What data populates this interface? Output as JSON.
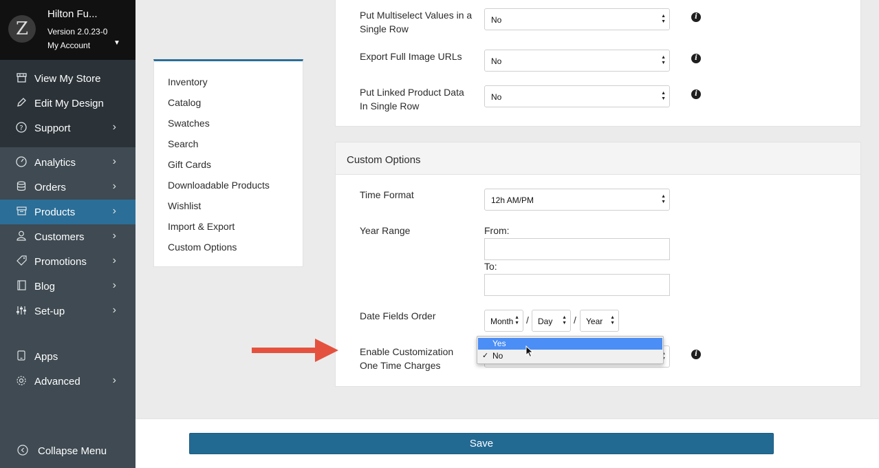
{
  "sidebar": {
    "store_name": "Hilton Fu...",
    "version": "Version 2.0.23-0",
    "account": "My Account",
    "logo_glyph": "Z",
    "group1": [
      {
        "label": "View My Store",
        "icon": "store-icon"
      },
      {
        "label": "Edit My Design",
        "icon": "pencil-icon"
      },
      {
        "label": "Support",
        "icon": "help-circle-icon"
      }
    ],
    "menu": [
      {
        "label": "Analytics",
        "icon": "gauge-icon"
      },
      {
        "label": "Orders",
        "icon": "database-icon"
      },
      {
        "label": "Products",
        "icon": "box-icon"
      },
      {
        "label": "Customers",
        "icon": "user-icon"
      },
      {
        "label": "Promotions",
        "icon": "tag-icon"
      },
      {
        "label": "Blog",
        "icon": "book-icon"
      },
      {
        "label": "Set-up",
        "icon": "sliders-icon"
      },
      {
        "label": "Apps",
        "icon": "mobile-icon"
      },
      {
        "label": "Advanced",
        "icon": "gear-icon"
      }
    ],
    "collapse": "Collapse Menu"
  },
  "settings_nav": [
    "Inventory",
    "Catalog",
    "Swatches",
    "Search",
    "Gift Cards",
    "Downloadable Products",
    "Wishlist",
    "Import & Export",
    "Custom Options"
  ],
  "export_panel": {
    "fields": [
      {
        "label": "Put Multiselect Values in a Single Row",
        "value": "No"
      },
      {
        "label": "Export Full Image URLs",
        "value": "No"
      },
      {
        "label": "Put Linked Product Data In Single Row",
        "value": "No"
      }
    ]
  },
  "custom_options": {
    "title": "Custom Options",
    "time_format_label": "Time Format",
    "time_format_value": "12h AM/PM",
    "year_range_label": "Year Range",
    "from_label": "From:",
    "to_label": "To:",
    "date_order_label": "Date Fields Order",
    "date_month": "Month",
    "date_day": "Day",
    "date_year": "Year",
    "separator": "/",
    "enable_label": "Enable Customization One Time Charges",
    "enable_value": "No"
  },
  "dropdown": {
    "options": [
      "Yes",
      "No"
    ],
    "highlighted": "Yes",
    "selected": "No",
    "check": "✓"
  },
  "footer": {
    "save_label": "Save"
  },
  "colors": {
    "accent": "#2b6e97",
    "highlight": "#4b8ef5",
    "arrow": "#e4523f",
    "sidebar": "#3f4a52"
  }
}
